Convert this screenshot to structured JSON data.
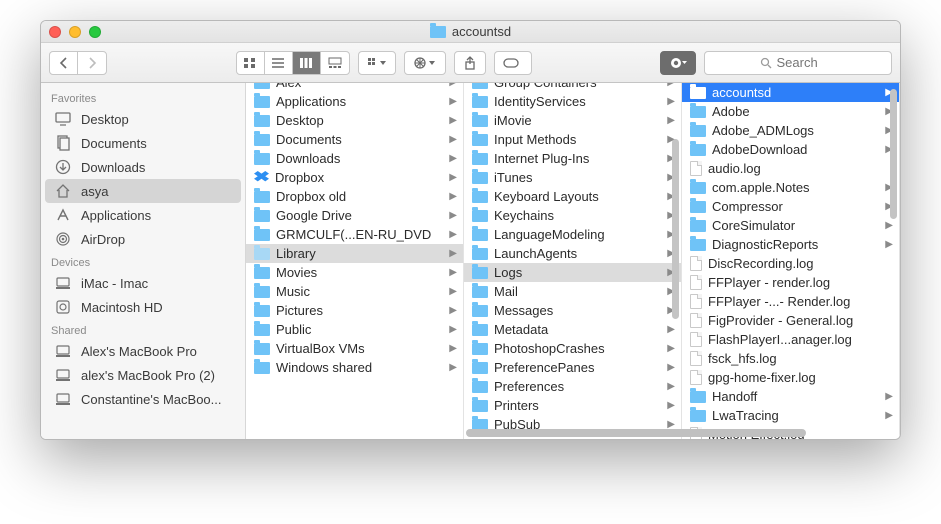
{
  "window": {
    "title": "accountsd"
  },
  "toolbar": {
    "search_placeholder": "Search"
  },
  "sidebar": {
    "sections": [
      {
        "header": "Favorites",
        "items": [
          {
            "label": "Desktop",
            "glyph": "desktop"
          },
          {
            "label": "Documents",
            "glyph": "documents"
          },
          {
            "label": "Downloads",
            "glyph": "downloads"
          },
          {
            "label": "asya",
            "glyph": "home",
            "selected": true
          },
          {
            "label": "Applications",
            "glyph": "applications"
          },
          {
            "label": "AirDrop",
            "glyph": "airdrop"
          }
        ]
      },
      {
        "header": "Devices",
        "items": [
          {
            "label": "iMac - Imac",
            "glyph": "computer"
          },
          {
            "label": "Macintosh HD",
            "glyph": "disk"
          }
        ]
      },
      {
        "header": "Shared",
        "items": [
          {
            "label": "Alex's MacBook Pro",
            "glyph": "computer"
          },
          {
            "label": "alex's MacBook Pro (2)",
            "glyph": "computer"
          },
          {
            "label": "Constantine's MacBoo...",
            "glyph": "computer"
          }
        ]
      }
    ]
  },
  "columns": [
    {
      "offset": -10,
      "items": [
        {
          "label": "Alex",
          "type": "folder",
          "arrow": true
        },
        {
          "label": "Applications",
          "type": "folder",
          "arrow": true
        },
        {
          "label": "Desktop",
          "type": "folder",
          "arrow": true
        },
        {
          "label": "Documents",
          "type": "folder",
          "arrow": true
        },
        {
          "label": "Downloads",
          "type": "folder",
          "arrow": true
        },
        {
          "label": "Dropbox",
          "type": "dropbox",
          "arrow": true
        },
        {
          "label": "Dropbox old",
          "type": "folder",
          "arrow": true
        },
        {
          "label": "Google Drive",
          "type": "folder",
          "arrow": true
        },
        {
          "label": "GRMCULF(...EN-RU_DVD",
          "type": "folder",
          "arrow": true
        },
        {
          "label": "Library",
          "type": "folder-dim",
          "arrow": true,
          "sel": "path"
        },
        {
          "label": "Movies",
          "type": "folder",
          "arrow": true
        },
        {
          "label": "Music",
          "type": "folder",
          "arrow": true
        },
        {
          "label": "Pictures",
          "type": "folder",
          "arrow": true
        },
        {
          "label": "Public",
          "type": "folder",
          "arrow": true
        },
        {
          "label": "VirtualBox VMs",
          "type": "folder",
          "arrow": true
        },
        {
          "label": "Windows shared",
          "type": "folder",
          "arrow": true
        }
      ]
    },
    {
      "offset": -10,
      "items": [
        {
          "label": "Group Containers",
          "type": "folder",
          "arrow": true
        },
        {
          "label": "IdentityServices",
          "type": "folder",
          "arrow": true
        },
        {
          "label": "iMovie",
          "type": "folder",
          "arrow": true
        },
        {
          "label": "Input Methods",
          "type": "folder",
          "arrow": true
        },
        {
          "label": "Internet Plug-Ins",
          "type": "folder",
          "arrow": true
        },
        {
          "label": "iTunes",
          "type": "folder",
          "arrow": true
        },
        {
          "label": "Keyboard Layouts",
          "type": "folder",
          "arrow": true
        },
        {
          "label": "Keychains",
          "type": "folder",
          "arrow": true
        },
        {
          "label": "LanguageModeling",
          "type": "folder",
          "arrow": true
        },
        {
          "label": "LaunchAgents",
          "type": "folder",
          "arrow": true
        },
        {
          "label": "Logs",
          "type": "folder",
          "arrow": true,
          "sel": "path"
        },
        {
          "label": "Mail",
          "type": "folder",
          "arrow": true
        },
        {
          "label": "Messages",
          "type": "folder",
          "arrow": true
        },
        {
          "label": "Metadata",
          "type": "folder",
          "arrow": true
        },
        {
          "label": "PhotoshopCrashes",
          "type": "folder",
          "arrow": true
        },
        {
          "label": "PreferencePanes",
          "type": "folder",
          "arrow": true
        },
        {
          "label": "Preferences",
          "type": "folder",
          "arrow": true
        },
        {
          "label": "Printers",
          "type": "folder",
          "arrow": true
        },
        {
          "label": "PubSub",
          "type": "folder",
          "arrow": true
        }
      ]
    },
    {
      "offset": 0,
      "items": [
        {
          "label": "accountsd",
          "type": "folder-white",
          "arrow": true,
          "sel": "active"
        },
        {
          "label": "Adobe",
          "type": "folder",
          "arrow": true
        },
        {
          "label": "Adobe_ADMLogs",
          "type": "folder",
          "arrow": true
        },
        {
          "label": "AdobeDownload",
          "type": "folder",
          "arrow": true
        },
        {
          "label": "audio.log",
          "type": "file"
        },
        {
          "label": "com.apple.Notes",
          "type": "folder",
          "arrow": true
        },
        {
          "label": "Compressor",
          "type": "folder",
          "arrow": true
        },
        {
          "label": "CoreSimulator",
          "type": "folder",
          "arrow": true
        },
        {
          "label": "DiagnosticReports",
          "type": "folder",
          "arrow": true
        },
        {
          "label": "DiscRecording.log",
          "type": "file"
        },
        {
          "label": "FFPlayer - render.log",
          "type": "file"
        },
        {
          "label": "FFPlayer -...- Render.log",
          "type": "file"
        },
        {
          "label": "FigProvider - General.log",
          "type": "file"
        },
        {
          "label": "FlashPlayerI...anager.log",
          "type": "file"
        },
        {
          "label": "fsck_hfs.log",
          "type": "file"
        },
        {
          "label": "gpg-home-fixer.log",
          "type": "file"
        },
        {
          "label": "Handoff",
          "type": "folder",
          "arrow": true
        },
        {
          "label": "LwaTracing",
          "type": "folder",
          "arrow": true
        },
        {
          "label": "Motion Effect.log",
          "type": "file"
        }
      ]
    }
  ]
}
